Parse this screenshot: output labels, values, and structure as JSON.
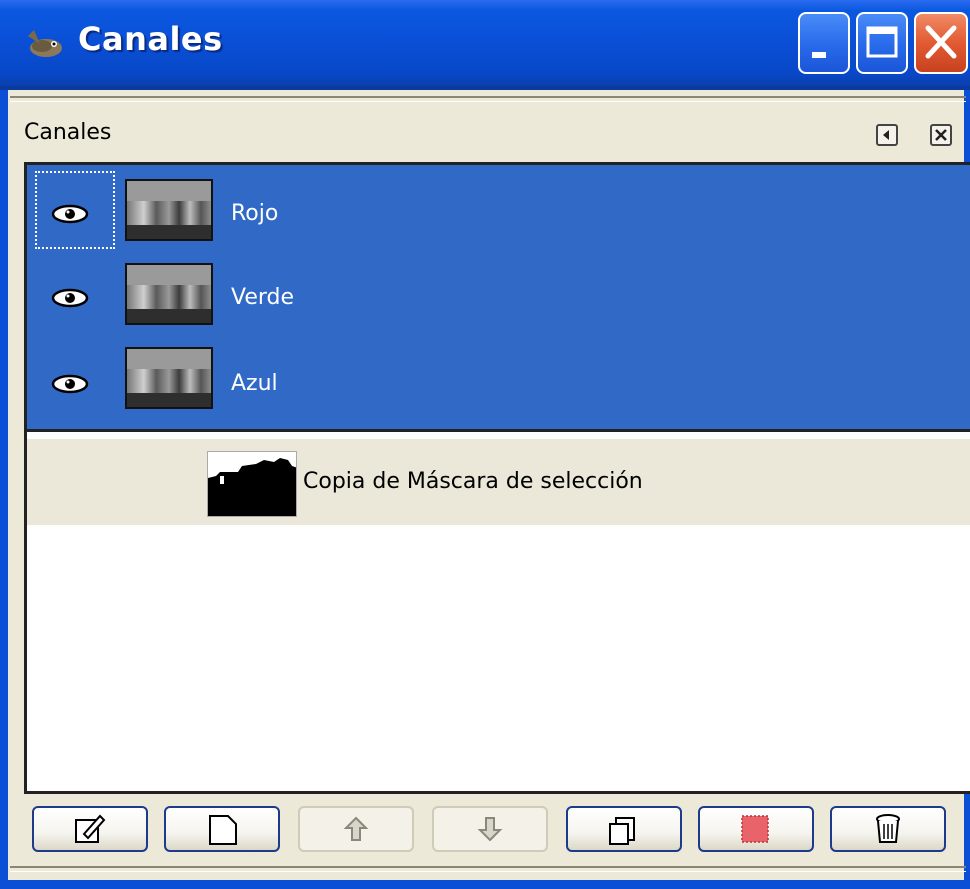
{
  "window": {
    "title": "Canales",
    "icon": "gimp-wilber-icon",
    "controls": [
      "minimize-icon",
      "maximize-icon",
      "close-icon"
    ]
  },
  "panel": {
    "title": "Canales",
    "header_icons": [
      "tab-menu-icon",
      "close-tab-icon"
    ]
  },
  "channels": [
    {
      "label": "Rojo",
      "visible": true,
      "selected": true,
      "focused": true
    },
    {
      "label": "Verde",
      "visible": true,
      "selected": true,
      "focused": false
    },
    {
      "label": "Azul",
      "visible": true,
      "selected": true,
      "focused": false
    }
  ],
  "saved_channels": [
    {
      "label": "Copia de Máscara de selección"
    }
  ],
  "toolbar": {
    "buttons": [
      {
        "icon": "edit-channel-attributes-icon",
        "enabled": true
      },
      {
        "icon": "new-channel-icon",
        "enabled": true
      },
      {
        "icon": "raise-channel-icon",
        "enabled": false
      },
      {
        "icon": "lower-channel-icon",
        "enabled": false
      },
      {
        "icon": "duplicate-channel-icon",
        "enabled": true
      },
      {
        "icon": "channel-to-selection-icon",
        "enabled": true
      },
      {
        "icon": "delete-channel-icon",
        "enabled": true
      }
    ]
  },
  "colors": {
    "titlebar": "#0a4fd6",
    "selection": "#3169c6",
    "dialog_bg": "#ece9d8",
    "close_button": "#e25a32"
  }
}
